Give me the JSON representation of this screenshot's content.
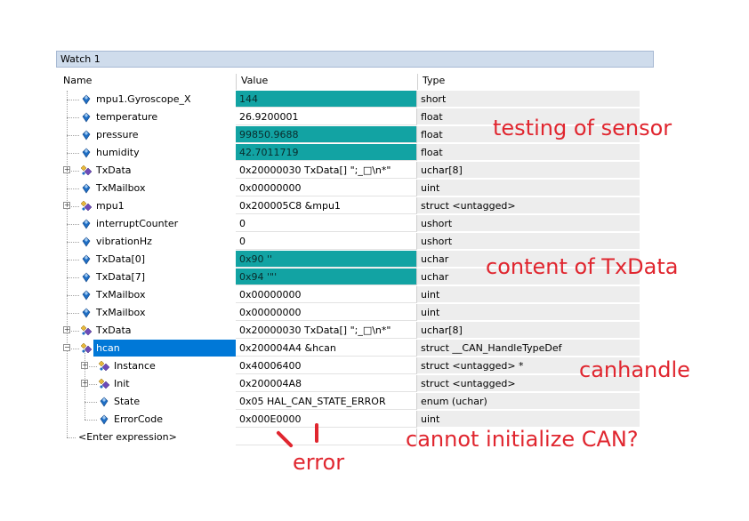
{
  "window": {
    "title": "Watch 1"
  },
  "columns": {
    "name": "Name",
    "value": "Value",
    "type": "Type"
  },
  "rows": [
    {
      "name": "mpu1.Gyroscope_X",
      "value": "144",
      "type": "short",
      "level": 0,
      "expander": "none",
      "icon": "field",
      "value_highlighted": true,
      "selected": false
    },
    {
      "name": "temperature",
      "value": "26.9200001",
      "type": "float",
      "level": 0,
      "expander": "none",
      "icon": "field",
      "value_highlighted": false,
      "selected": false
    },
    {
      "name": "pressure",
      "value": "99850.9688",
      "type": "float",
      "level": 0,
      "expander": "none",
      "icon": "field",
      "value_highlighted": true,
      "selected": false
    },
    {
      "name": "humidity",
      "value": "42.7011719",
      "type": "float",
      "level": 0,
      "expander": "none",
      "icon": "field",
      "value_highlighted": true,
      "selected": false
    },
    {
      "name": "TxData",
      "value": "0x20000030 TxData[] \";_□\\n*\"",
      "type": "uchar[8]",
      "level": 0,
      "expander": "plus",
      "icon": "struct",
      "value_highlighted": false,
      "selected": false
    },
    {
      "name": "TxMailbox",
      "value": "0x00000000",
      "type": "uint",
      "level": 0,
      "expander": "none",
      "icon": "field",
      "value_highlighted": false,
      "selected": false
    },
    {
      "name": "mpu1",
      "value": "0x200005C8 &mpu1",
      "type": "struct <untagged>",
      "level": 0,
      "expander": "plus",
      "icon": "struct",
      "value_highlighted": false,
      "selected": false
    },
    {
      "name": "interruptCounter",
      "value": "0",
      "type": "ushort",
      "level": 0,
      "expander": "none",
      "icon": "field",
      "value_highlighted": false,
      "selected": false
    },
    {
      "name": "vibrationHz",
      "value": "0",
      "type": "ushort",
      "level": 0,
      "expander": "none",
      "icon": "field",
      "value_highlighted": false,
      "selected": false
    },
    {
      "name": "TxData[0]",
      "value": "0x90 ''",
      "type": "uchar",
      "level": 0,
      "expander": "none",
      "icon": "field",
      "value_highlighted": true,
      "selected": false
    },
    {
      "name": "TxData[7]",
      "value": "0x94 '\"'",
      "type": "uchar",
      "level": 0,
      "expander": "none",
      "icon": "field",
      "value_highlighted": true,
      "selected": false
    },
    {
      "name": "TxMailbox",
      "value": "0x00000000",
      "type": "uint",
      "level": 0,
      "expander": "none",
      "icon": "field",
      "value_highlighted": false,
      "selected": false
    },
    {
      "name": "TxMailbox",
      "value": "0x00000000",
      "type": "uint",
      "level": 0,
      "expander": "none",
      "icon": "field",
      "value_highlighted": false,
      "selected": false
    },
    {
      "name": "TxData",
      "value": "0x20000030 TxData[] \";_□\\n*\"",
      "type": "uchar[8]",
      "level": 0,
      "expander": "plus",
      "icon": "struct",
      "value_highlighted": false,
      "selected": false
    },
    {
      "name": "hcan",
      "value": "0x200004A4 &hcan",
      "type": "struct __CAN_HandleTypeDef",
      "level": 0,
      "expander": "minus",
      "icon": "struct",
      "value_highlighted": false,
      "selected": true
    },
    {
      "name": "Instance",
      "value": "0x40006400",
      "type": "struct <untagged> *",
      "level": 1,
      "expander": "plus",
      "icon": "struct",
      "value_highlighted": false,
      "selected": false
    },
    {
      "name": "Init",
      "value": "0x200004A8",
      "type": "struct <untagged>",
      "level": 1,
      "expander": "plus",
      "icon": "struct",
      "value_highlighted": false,
      "selected": false
    },
    {
      "name": "State",
      "value": "0x05 HAL_CAN_STATE_ERROR",
      "type": "enum (uchar)",
      "level": 1,
      "expander": "none",
      "icon": "field",
      "value_highlighted": false,
      "selected": false
    },
    {
      "name": "ErrorCode",
      "value": "0x000E0000",
      "type": "uint",
      "level": 1,
      "expander": "none",
      "icon": "field",
      "value_highlighted": false,
      "selected": false
    },
    {
      "name": "<Enter expression>",
      "value": "",
      "type": "",
      "level": 0,
      "expander": "none",
      "icon": "none",
      "value_highlighted": false,
      "selected": false
    }
  ],
  "annotations": {
    "testing": "testing of sensor",
    "content": "content of TxData",
    "canhandle": "canhandle",
    "cannot": "cannot initialize CAN?",
    "error": "error"
  },
  "colors": {
    "highlight": "#12a3a3",
    "selection": "#0078d7",
    "annotation": "#e0262f",
    "titlebar": "#cfdcec"
  }
}
